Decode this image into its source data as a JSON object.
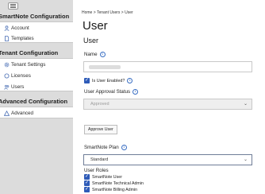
{
  "sidebar": {
    "sections": [
      {
        "title": "SmartNote Configuration",
        "items": [
          {
            "label": "Account",
            "icon": "user-icon"
          },
          {
            "label": "Templates",
            "icon": "document-icon"
          }
        ]
      },
      {
        "title": "Tenant Configuration",
        "items": [
          {
            "label": "Tenant Settings",
            "icon": "gear-icon"
          },
          {
            "label": "Licenses",
            "icon": "circle-icon"
          },
          {
            "label": "Users",
            "icon": "users-icon"
          }
        ]
      },
      {
        "title": "Advanced Configuration",
        "items": [
          {
            "label": "Advanced",
            "icon": "warning-icon"
          }
        ]
      }
    ]
  },
  "breadcrumb": "Home > Tenant Users > User",
  "page": {
    "title": "User",
    "subtitle": "User",
    "name_label": "Name",
    "enabled_label": "Is User Enabled?",
    "enabled_checked": true,
    "approval_label": "User Approval Status",
    "approval_value": "Approved",
    "approve_button": "Approve User",
    "plan_label": "SmartNote Plan",
    "plan_value": "Standard",
    "roles_label": "User Roles",
    "roles": [
      {
        "label": "SmartNote User",
        "checked": true
      },
      {
        "label": "SmartNote Technical Admin",
        "checked": true
      },
      {
        "label": "SmartNote Billing Admin",
        "checked": true
      }
    ]
  },
  "colors": {
    "accent": "#2e5bb8",
    "sidebar_bg": "#dcdcdc"
  }
}
